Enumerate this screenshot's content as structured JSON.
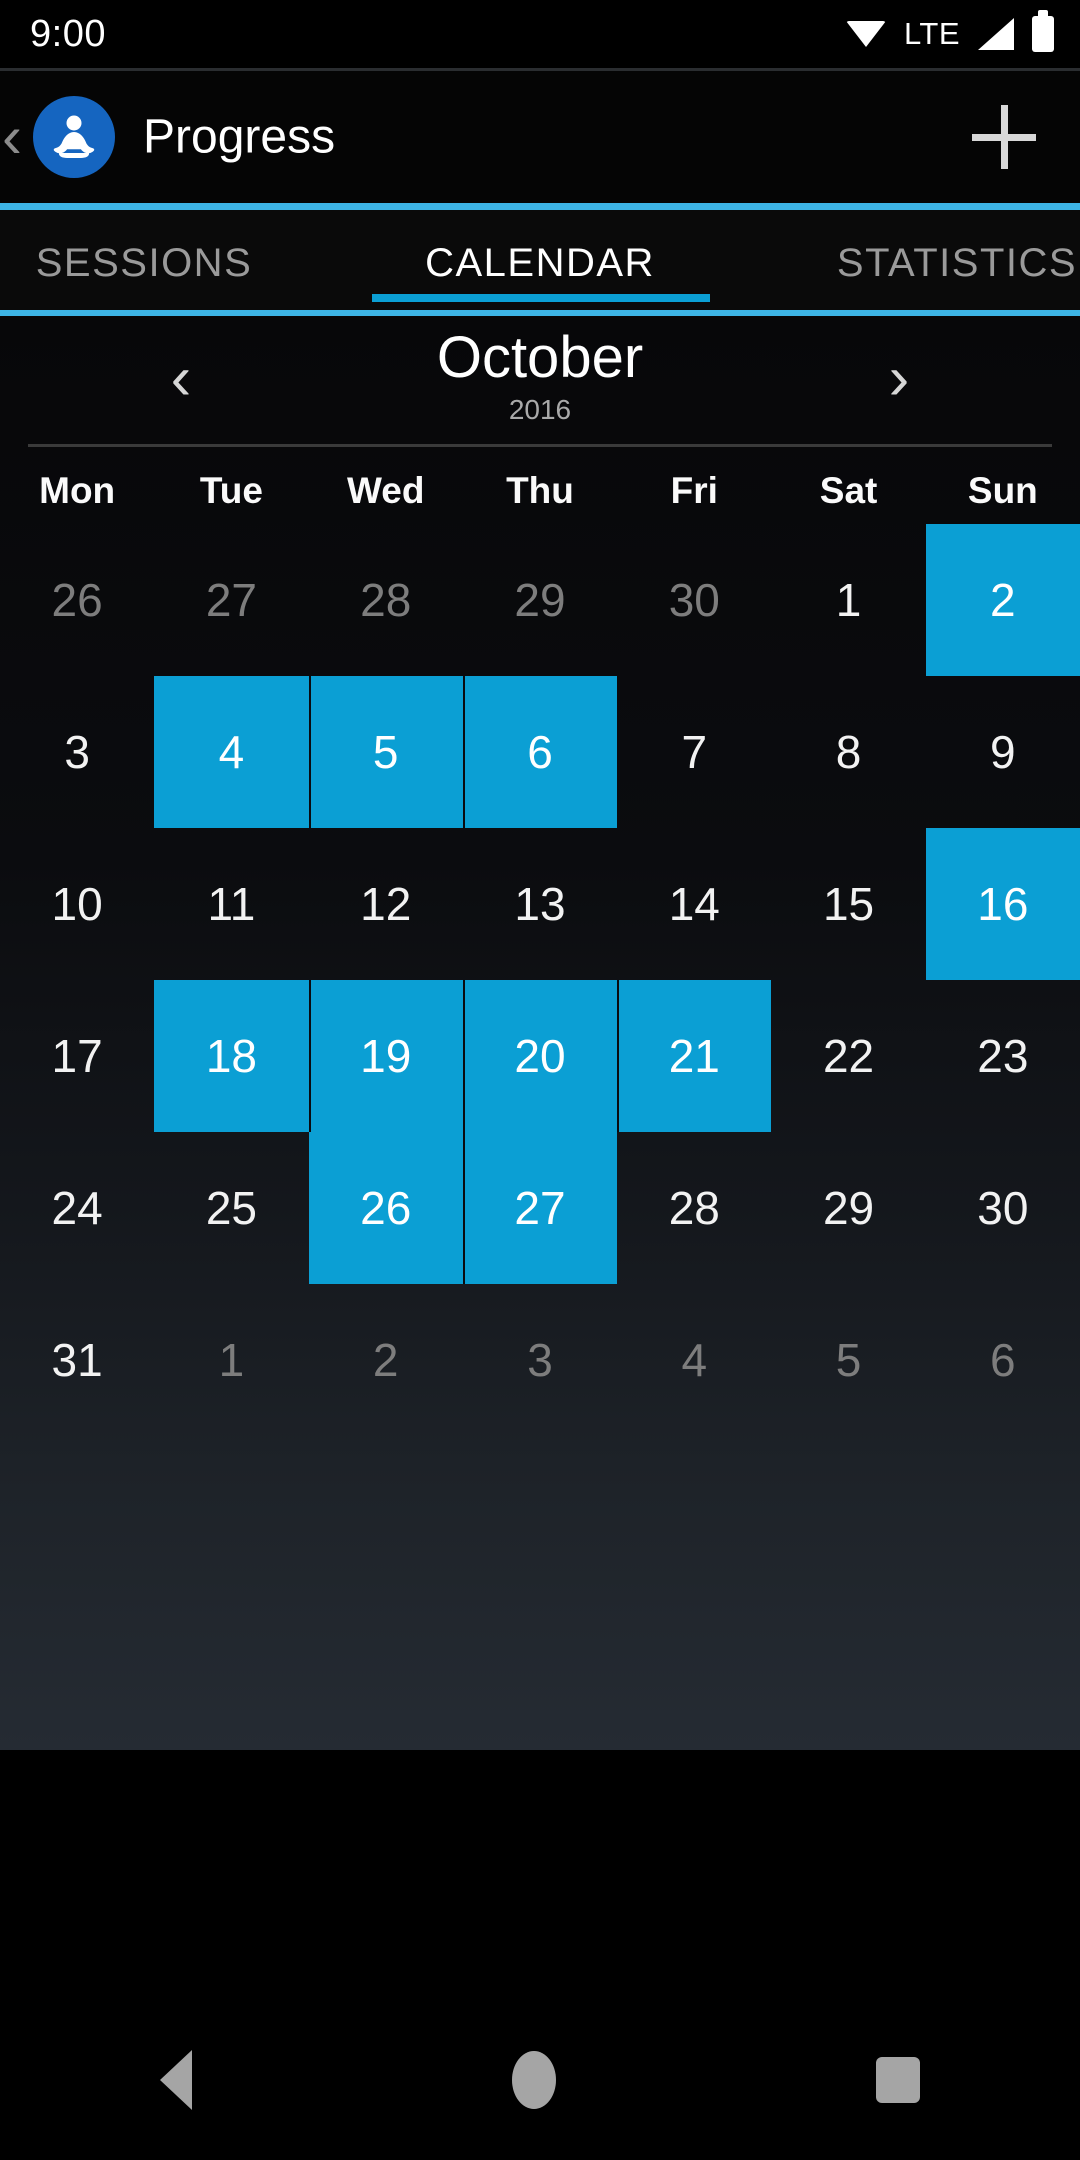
{
  "status_bar": {
    "clock": "9:00",
    "network_label": "LTE",
    "icons": [
      "wifi-icon",
      "signal-icon",
      "battery-icon"
    ]
  },
  "app_bar": {
    "back_label": "‹",
    "logo": "meditation-logo-icon",
    "title": "Progress",
    "add_label": "+"
  },
  "tabs": {
    "items": [
      {
        "label": "SESSIONS",
        "active": false
      },
      {
        "label": "CALENDAR",
        "active": true
      },
      {
        "label": "STATISTICS",
        "active": false
      }
    ]
  },
  "calendar": {
    "month": "October",
    "year": "2016",
    "prev_label": "‹",
    "next_label": "›",
    "weekdays": [
      "Mon",
      "Tue",
      "Wed",
      "Thu",
      "Fri",
      "Sat",
      "Sun"
    ],
    "accent_color": "#0B9FD4",
    "days": [
      {
        "label": "26",
        "state": "muted"
      },
      {
        "label": "27",
        "state": "muted"
      },
      {
        "label": "28",
        "state": "muted"
      },
      {
        "label": "29",
        "state": "muted"
      },
      {
        "label": "30",
        "state": "muted"
      },
      {
        "label": "1",
        "state": "normal"
      },
      {
        "label": "2",
        "state": "marked"
      },
      {
        "label": "3",
        "state": "normal"
      },
      {
        "label": "4",
        "state": "marked"
      },
      {
        "label": "5",
        "state": "marked"
      },
      {
        "label": "6",
        "state": "marked"
      },
      {
        "label": "7",
        "state": "normal"
      },
      {
        "label": "8",
        "state": "normal"
      },
      {
        "label": "9",
        "state": "normal"
      },
      {
        "label": "10",
        "state": "normal"
      },
      {
        "label": "11",
        "state": "normal"
      },
      {
        "label": "12",
        "state": "normal"
      },
      {
        "label": "13",
        "state": "normal"
      },
      {
        "label": "14",
        "state": "normal"
      },
      {
        "label": "15",
        "state": "normal"
      },
      {
        "label": "16",
        "state": "marked"
      },
      {
        "label": "17",
        "state": "normal"
      },
      {
        "label": "18",
        "state": "marked"
      },
      {
        "label": "19",
        "state": "marked"
      },
      {
        "label": "20",
        "state": "marked"
      },
      {
        "label": "21",
        "state": "marked"
      },
      {
        "label": "22",
        "state": "normal"
      },
      {
        "label": "23",
        "state": "normal"
      },
      {
        "label": "24",
        "state": "normal"
      },
      {
        "label": "25",
        "state": "normal"
      },
      {
        "label": "26",
        "state": "marked"
      },
      {
        "label": "27",
        "state": "marked"
      },
      {
        "label": "28",
        "state": "normal"
      },
      {
        "label": "29",
        "state": "normal"
      },
      {
        "label": "30",
        "state": "normal"
      },
      {
        "label": "31",
        "state": "normal"
      },
      {
        "label": "1",
        "state": "muted"
      },
      {
        "label": "2",
        "state": "muted"
      },
      {
        "label": "3",
        "state": "muted"
      },
      {
        "label": "4",
        "state": "muted"
      },
      {
        "label": "5",
        "state": "muted"
      },
      {
        "label": "6",
        "state": "muted"
      }
    ]
  },
  "system_nav": {
    "back": "back-triangle-icon",
    "home": "home-circle-icon",
    "recents": "recents-square-icon"
  }
}
